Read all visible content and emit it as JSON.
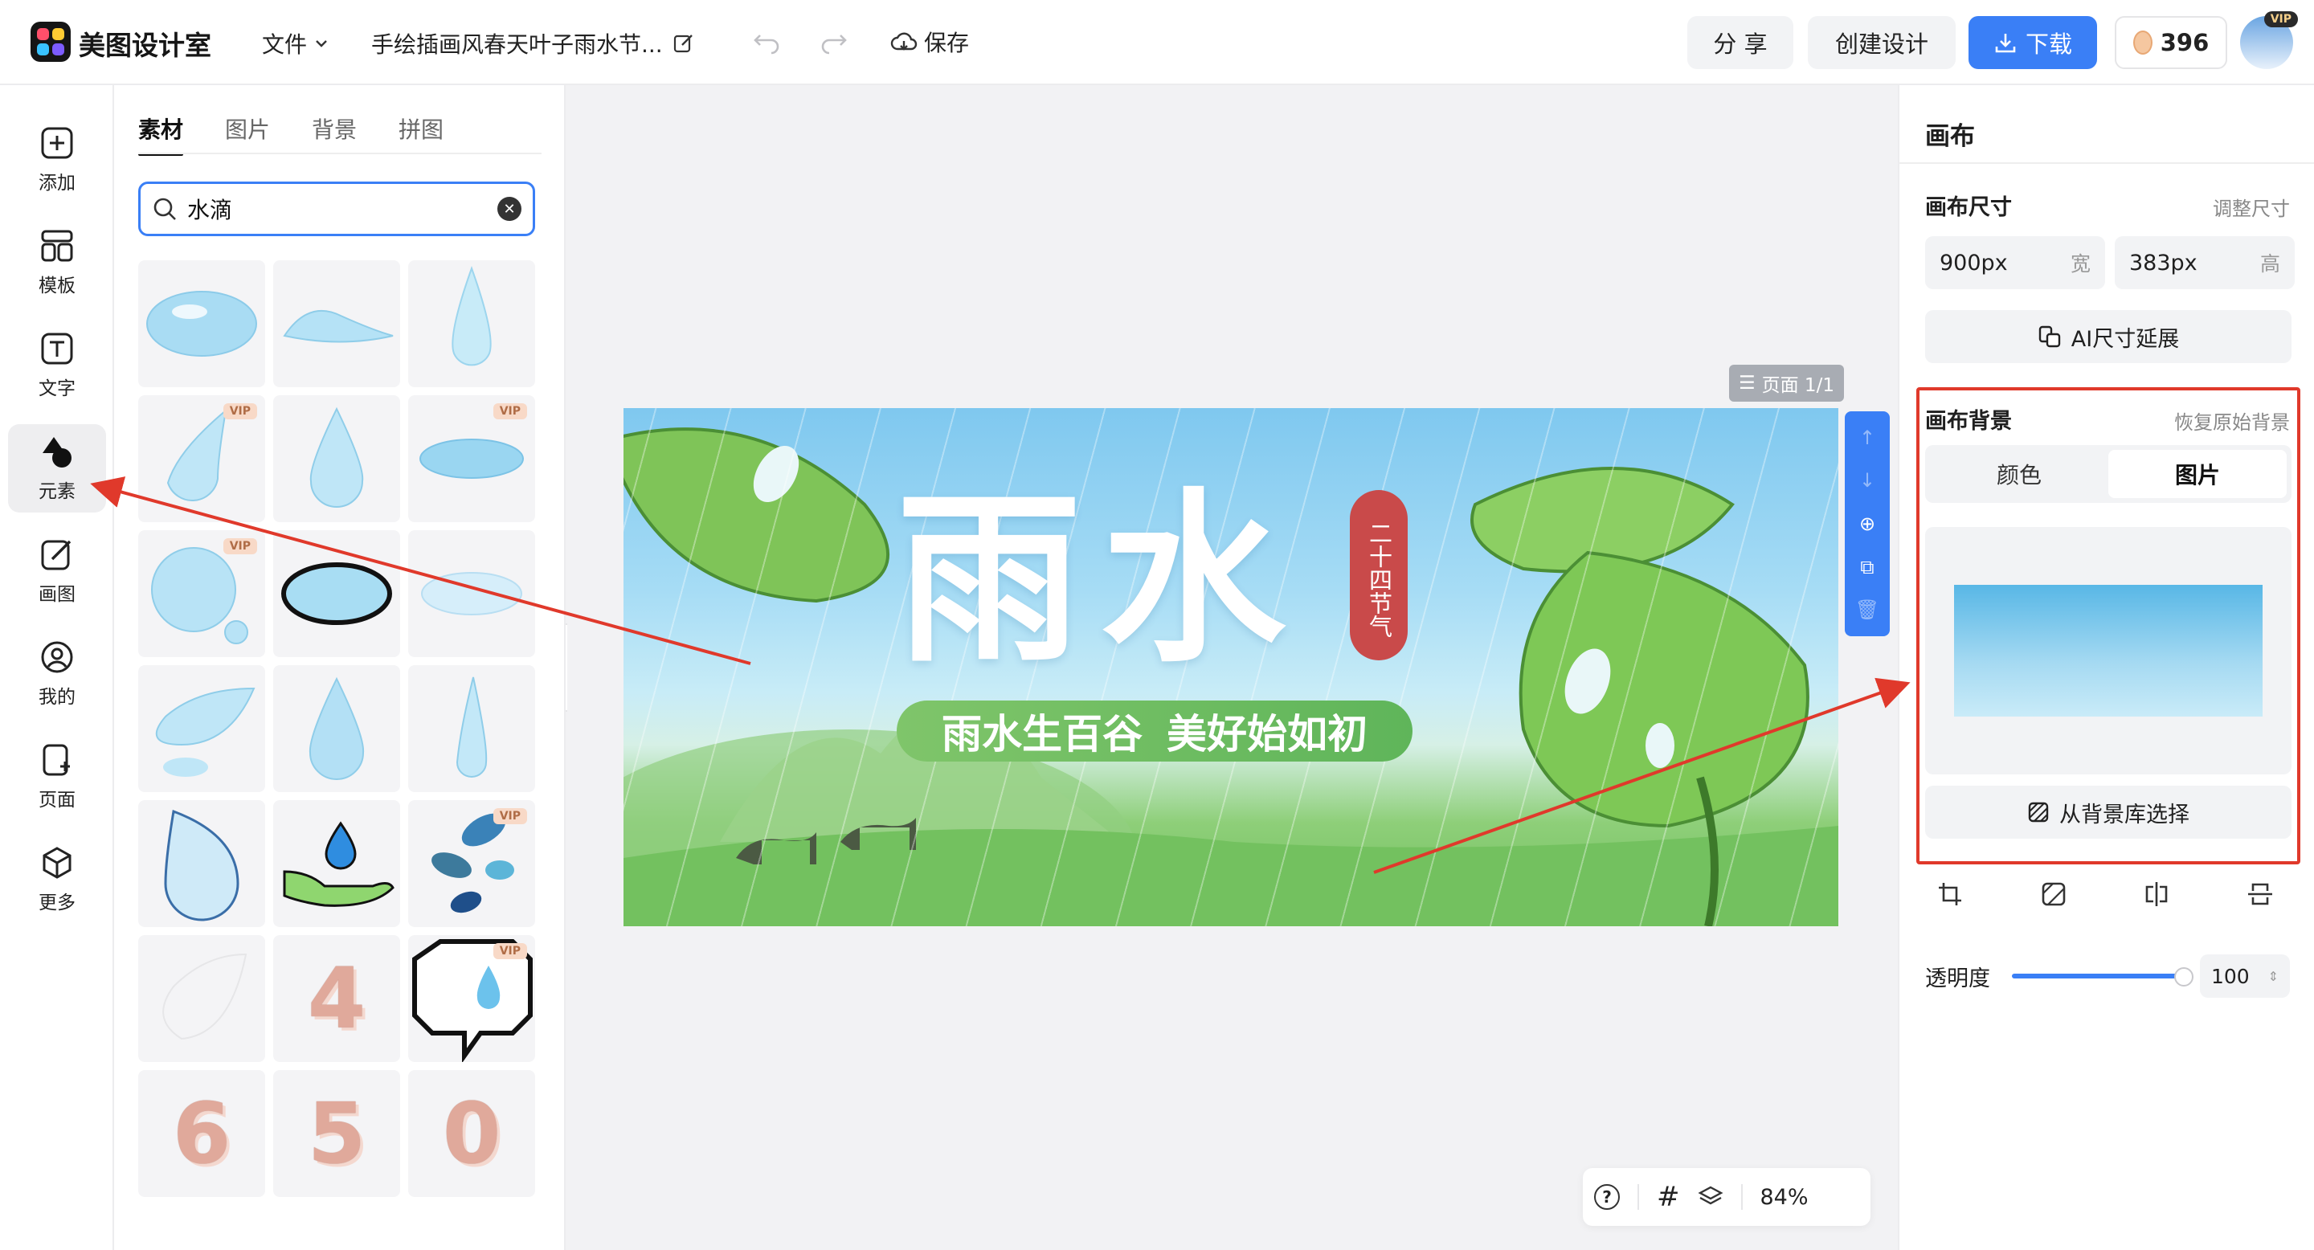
{
  "app": {
    "name": "美图设计室"
  },
  "toolbar": {
    "file_menu": "文件",
    "doc_title": "手绘插画风春天叶子雨水节...",
    "save": "保存",
    "share": "分 享",
    "create_design": "创建设计",
    "download": "下载",
    "coins": "396",
    "vip_badge": "VIP"
  },
  "leftnav": [
    "添加",
    "模板",
    "文字",
    "元素",
    "画图",
    "我的",
    "页面",
    "更多"
  ],
  "panel": {
    "tabs": [
      "素材",
      "图片",
      "背景",
      "拼图"
    ],
    "search_value": "水滴",
    "vip_label": "VIP",
    "numbers": [
      "4",
      "6",
      "5",
      "0"
    ]
  },
  "canvas": {
    "page_label": "页面 1/1",
    "title": "雨水",
    "seal": "二十四节气",
    "subtitle_a": "雨水生百谷",
    "subtitle_b": "美好始如初"
  },
  "bottom": {
    "help": "?",
    "grid": "#",
    "zoom": "84%"
  },
  "right": {
    "title": "画布",
    "size_label": "画布尺寸",
    "resize_link": "调整尺寸",
    "width_val": "900px",
    "width_unit": "宽",
    "height_val": "383px",
    "height_unit": "高",
    "ai_extend": "AI尺寸延展",
    "bg_label": "画布背景",
    "restore_link": "恢复原始背景",
    "seg_color": "颜色",
    "seg_image": "图片",
    "from_library": "从背景库选择",
    "opacity_label": "透明度",
    "opacity_value": "100"
  },
  "colors": {
    "accent": "#3a7ff6",
    "annotation": "#e0392b",
    "seal": "#c94a4a"
  }
}
